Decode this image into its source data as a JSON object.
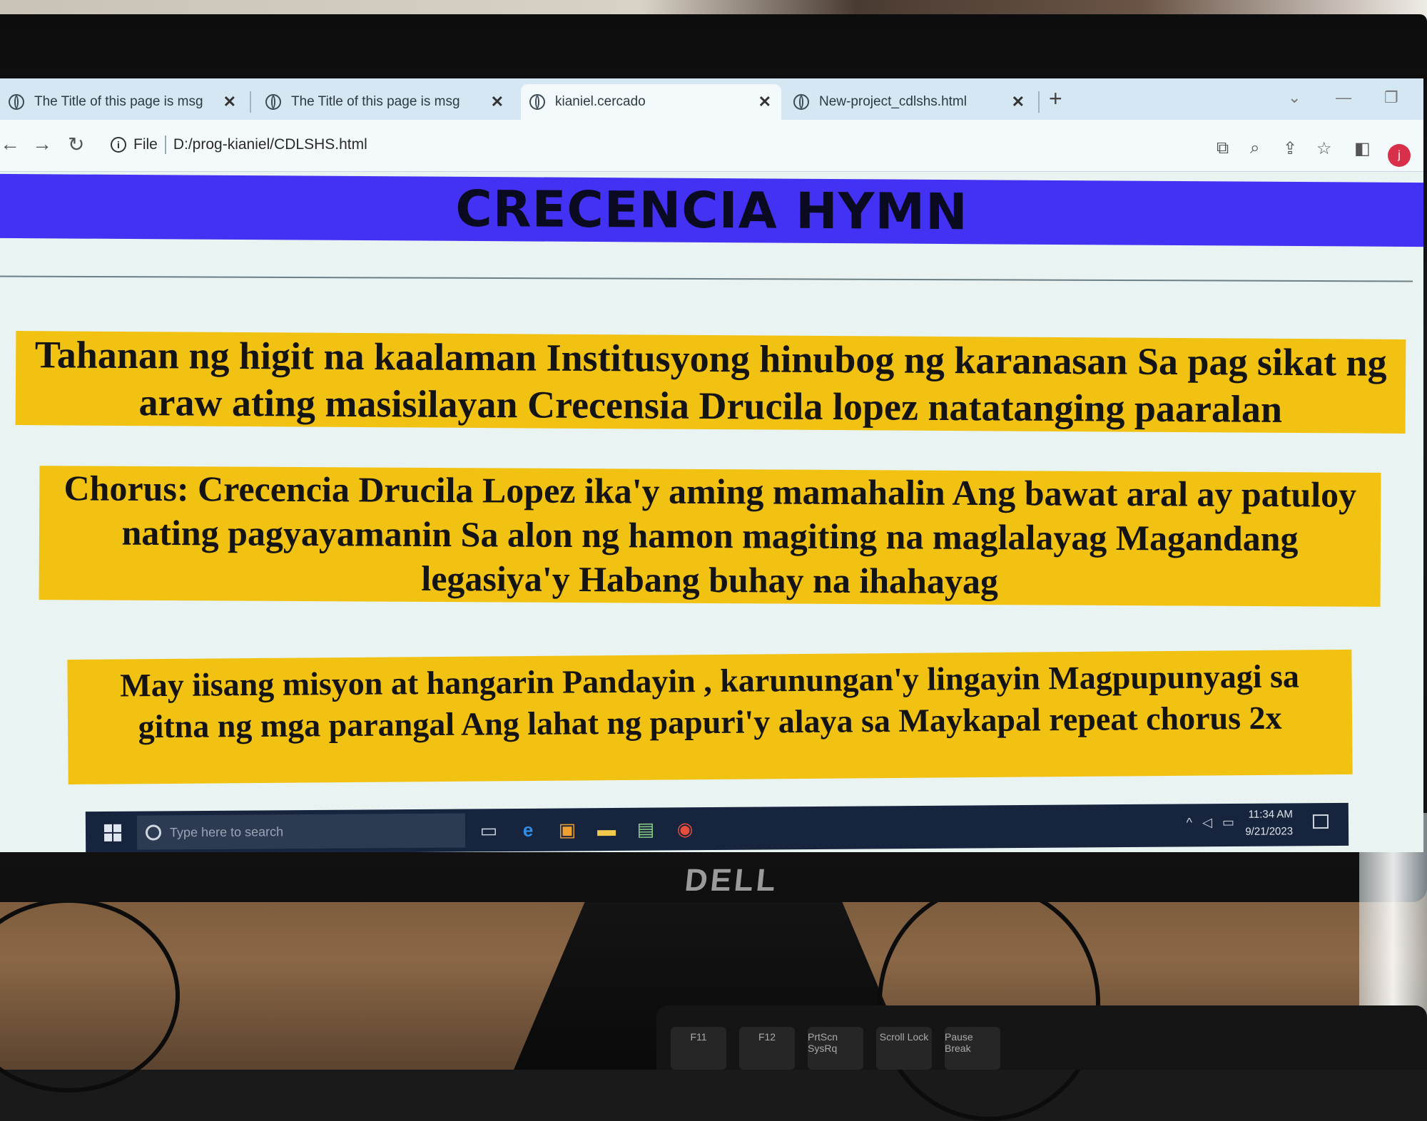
{
  "browser": {
    "tabs": [
      {
        "title": "The Title of this page is msg",
        "active": false
      },
      {
        "title": "The Title of this page is msg",
        "active": false
      },
      {
        "title": "kianiel.cercado",
        "active": true
      },
      {
        "title": "New-project_cdlshs.html",
        "active": false
      }
    ],
    "new_tab": "+",
    "address": {
      "scheme_label": "File",
      "path": "D:/prog-kianiel/CDLSHS.html"
    },
    "profile_initial": "j"
  },
  "page": {
    "title": "CRECENCIA HYMN",
    "verses": [
      "Tahanan ng higit na kaalaman Institusyong hinubog ng karanasan Sa pag sikat ng araw ating masisilayan Crecensia Drucila lopez natatanging paaralan",
      "Chorus: Crecencia Drucila Lopez ika'y aming mamahalin Ang bawat aral ay patuloy nating pagyayamanin Sa alon ng hamon magiting na maglalayag Magandang legasiya'y Habang buhay na ihahayag",
      "May iisang misyon at hangarin Pandayin , karunungan'y lingayin Magpupunyagi sa gitna ng mga parangal Ang lahat ng papuri'y alaya sa Maykapal repeat chorus 2x"
    ],
    "colors": {
      "header_bg": "#4332f4",
      "verse_bg": "#f2c212",
      "page_bg": "#e9f3f1"
    }
  },
  "taskbar": {
    "search_placeholder": "Type here to search",
    "time": "11:34 AM",
    "date": "9/21/2023"
  },
  "monitor": {
    "brand": "DELL"
  },
  "keyboard": {
    "keys": [
      "F11",
      "F12",
      "PrtScn SysRq",
      "Scroll Lock",
      "Pause Break"
    ]
  }
}
